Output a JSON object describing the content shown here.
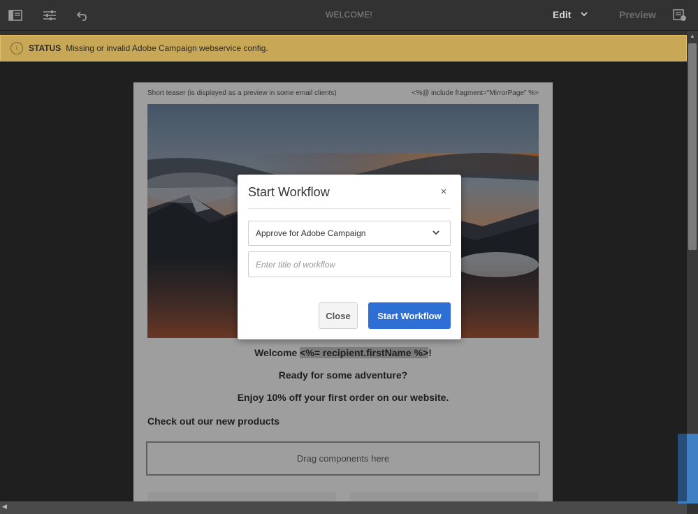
{
  "toolbar": {
    "title": "WELCOME!",
    "mode_label": "Edit",
    "preview_label": "Preview",
    "icons": [
      "sidepanel-icon",
      "properties-icon",
      "undo-icon",
      "chevron-down-icon",
      "page-info-icon"
    ]
  },
  "status": {
    "label": "STATUS",
    "message": "Missing or invalid Adobe Campaign webservice config.",
    "background": "#c8a856"
  },
  "email": {
    "teaser": "Short teaser (is displayed as a preview in some email clients)",
    "mirror_fragment": "<%@ include fragment=\"MirrorPage\" %>",
    "welcome_prefix": "Welcome ",
    "welcome_var": "<%= recipient.firstName %>",
    "welcome_suffix": "!",
    "adventure": "Ready for some adventure?",
    "offer": "Enjoy 10% off your first order on our website.",
    "products_heading": "Check out our new products",
    "dropzone": "Drag components here"
  },
  "dialog": {
    "title": "Start Workflow",
    "close_icon": "×",
    "model_select_value": "Approve for Adobe Campaign",
    "title_placeholder": "Enter title of workflow",
    "close_button": "Close",
    "start_button": "Start Workflow",
    "accent": "#2d6fd4"
  }
}
